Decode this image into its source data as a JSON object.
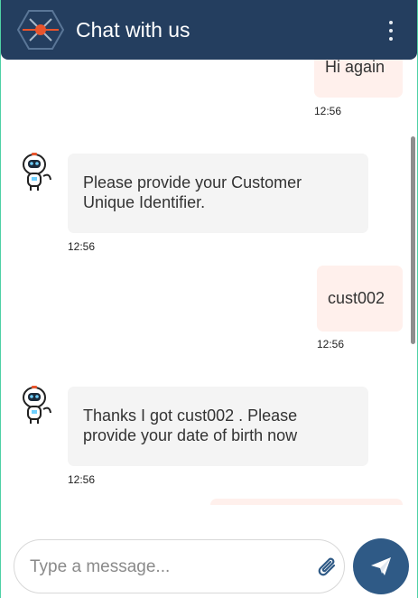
{
  "header": {
    "title": "Chat with us"
  },
  "messages": [
    {
      "sender": "user",
      "text": "Hi again",
      "time": "12:56"
    },
    {
      "sender": "bot",
      "text": "Please provide your Customer Unique Identifier.",
      "time": "12:56"
    },
    {
      "sender": "user",
      "text": "cust002",
      "time": "12:56"
    },
    {
      "sender": "bot",
      "text": "Thanks I got cust002 . Please provide your date of birth now",
      "time": "12:56"
    }
  ],
  "composer": {
    "placeholder": "Type a message...",
    "value": ""
  },
  "icons": {
    "logo": "drone-hexagon-logo",
    "menu": "more-vertical-icon",
    "avatar": "robot-avatar-icon",
    "attach": "paperclip-icon",
    "send": "paper-plane-icon"
  },
  "colors": {
    "header": "#243e5f",
    "accent": "#e8542c",
    "user_bubble": "#fff0ec",
    "bot_bubble": "#f4f4f4",
    "send_button": "#2f5a86",
    "frame_border": "#4fd1a5"
  }
}
